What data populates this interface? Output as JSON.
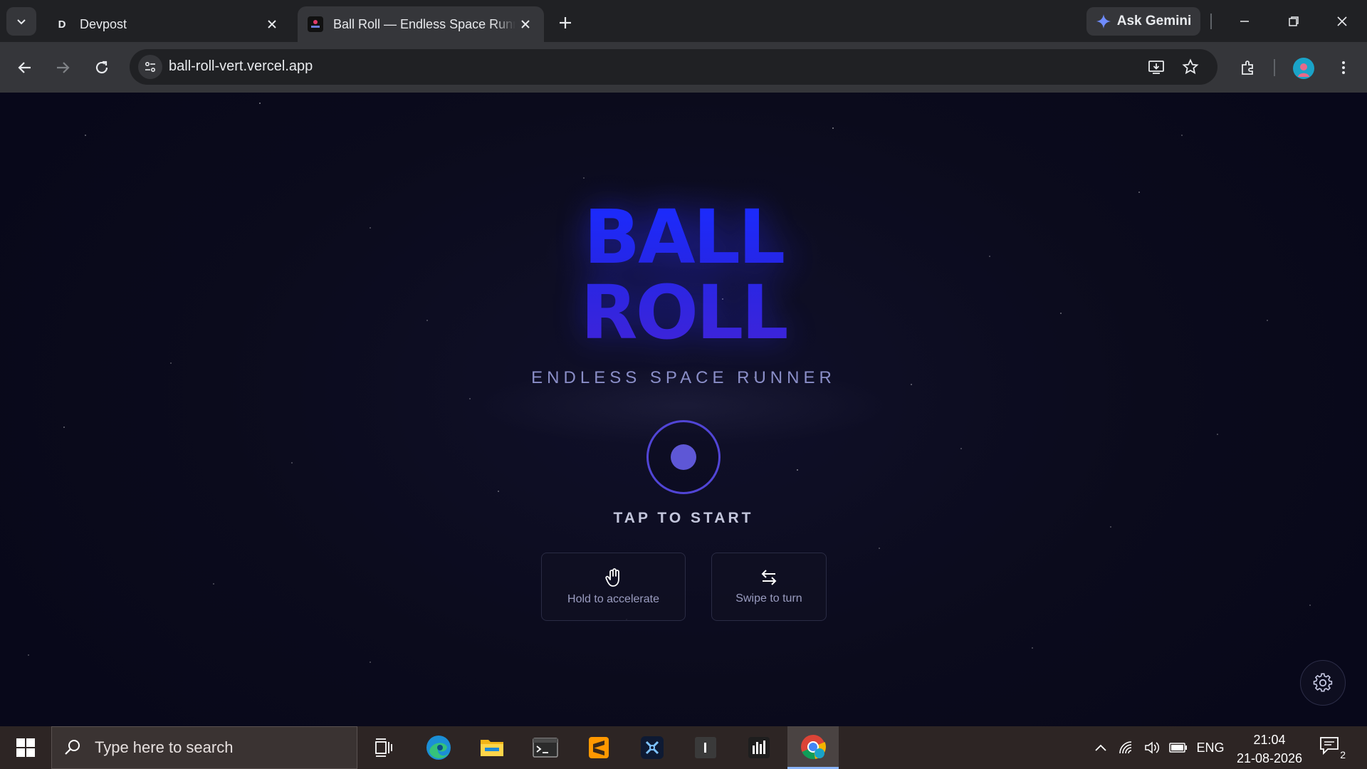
{
  "browser": {
    "tabs": [
      {
        "title": "Devpost",
        "favicon": "D",
        "active": false
      },
      {
        "title": "Ball Roll — Endless Space Runner",
        "active": true
      }
    ],
    "ask_gemini": "Ask Gemini",
    "url": "ball-roll-vert.vercel.app"
  },
  "game": {
    "title_line1": "BALL",
    "title_line2": "ROLL",
    "subtitle": "ENDLESS SPACE RUNNER",
    "tap_to_start": "TAP TO START",
    "hints": [
      {
        "icon": "hand-icon",
        "label": "Hold to accelerate"
      },
      {
        "icon": "swap-arrows-icon",
        "label": "Swipe to turn"
      }
    ]
  },
  "taskbar": {
    "search_placeholder": "Type here to search",
    "language": "ENG",
    "time": "21:04",
    "date": "21-08-2026",
    "notification_count": "2"
  },
  "colors": {
    "title_blue": "#1a2bff",
    "title_violet": "#3f24d8",
    "ring": "#5145d6",
    "background": "#0b0b1c"
  }
}
